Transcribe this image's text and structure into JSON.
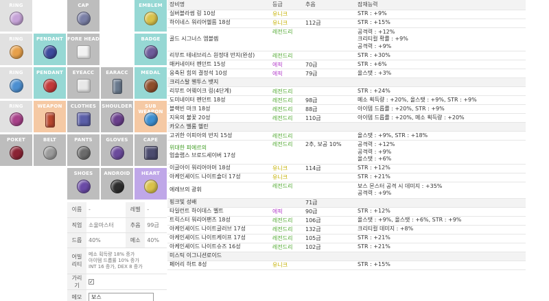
{
  "slots": [
    {
      "id": "ring1",
      "label": "RING",
      "bg": "#e1e1e1",
      "icon": "ring-icon",
      "color": "#c6a3d8"
    },
    {
      "id": "empty1",
      "label": "",
      "bg": "#ffffff",
      "icon": "",
      "color": ""
    },
    {
      "id": "cap",
      "label": "CAP",
      "bg": "#bdbdbd",
      "icon": "cap-icon",
      "color": "#7a7fa6"
    },
    {
      "id": "empty2",
      "label": "",
      "bg": "#ffffff",
      "icon": "",
      "color": ""
    },
    {
      "id": "emblem",
      "label": "EMBLEM",
      "bg": "#96d8d4",
      "icon": "emblem-icon",
      "color": "#d9c24a"
    },
    {
      "id": "ring2",
      "label": "RING",
      "bg": "#e1e1e1",
      "icon": "ring-icon",
      "color": "#e7a04a"
    },
    {
      "id": "pendant1",
      "label": "PENDANT",
      "bg": "#96d8d4",
      "icon": "pendant-icon",
      "color": "#3d4a9c"
    },
    {
      "id": "forehead",
      "label": "FORE HEAD",
      "bg": "#bdbdbd",
      "icon": "forehead-icon",
      "color": "#f2f2f2"
    },
    {
      "id": "empty3",
      "label": "",
      "bg": "#ffffff",
      "icon": "",
      "color": ""
    },
    {
      "id": "badge",
      "label": "BADGE",
      "bg": "#96d8d4",
      "icon": "badge-icon",
      "color": "#6d5b9a"
    },
    {
      "id": "ring3",
      "label": "RING",
      "bg": "#e1e1e1",
      "icon": "ring-icon",
      "color": "#4c8fd1"
    },
    {
      "id": "pendant2",
      "label": "PENDANT",
      "bg": "#96d8d4",
      "icon": "pendant-icon",
      "color": "#c23a3a"
    },
    {
      "id": "eyeacc",
      "label": "EYEACC",
      "bg": "#bdbdbd",
      "icon": "eyeacc-icon",
      "color": "#e8e8e8"
    },
    {
      "id": "earacc",
      "label": "EARACC",
      "bg": "#bdbdbd",
      "icon": "earacc-icon",
      "color": "#6a7a8e"
    },
    {
      "id": "medal",
      "label": "MEDAL",
      "bg": "#96d8d4",
      "icon": "medal-icon",
      "color": "#8e4e2b"
    },
    {
      "id": "ring4",
      "label": "RING",
      "bg": "#e1e1e1",
      "icon": "ring-icon",
      "color": "#a8418a"
    },
    {
      "id": "weapon",
      "label": "WEAPON",
      "bg": "#f5c9a4",
      "icon": "weapon-icon",
      "color": "#b8462e"
    },
    {
      "id": "clothes",
      "label": "CLOTHES",
      "bg": "#bdbdbd",
      "icon": "clothes-icon",
      "color": "#5b5fa8"
    },
    {
      "id": "shoulder",
      "label": "SHOULDER",
      "bg": "#bdbdbd",
      "icon": "shoulder-icon",
      "color": "#6a3f8c"
    },
    {
      "id": "subweapon",
      "label": "SUB WEAPON",
      "bg": "#f5c9a4",
      "icon": "subweapon-icon",
      "color": "#3d8fd1"
    },
    {
      "id": "pocket",
      "label": "POKET",
      "bg": "#bdbdbd",
      "icon": "pocket-icon",
      "color": "#8b2334"
    },
    {
      "id": "belt",
      "label": "BELT",
      "bg": "#bdbdbd",
      "icon": "belt-icon",
      "color": "#9a9a9a"
    },
    {
      "id": "pants",
      "label": "PANTS",
      "bg": "#bdbdbd",
      "icon": "pants-icon",
      "color": "#6b6b6b"
    },
    {
      "id": "gloves",
      "label": "GLOVES",
      "bg": "#bdbdbd",
      "icon": "gloves-icon",
      "color": "#6b4a9c"
    },
    {
      "id": "cape",
      "label": "CAPE",
      "bg": "#bdbdbd",
      "icon": "cape-icon",
      "color": "#4b4b6e"
    },
    {
      "id": "empty4",
      "label": "",
      "bg": "#ffffff",
      "icon": "",
      "color": ""
    },
    {
      "id": "empty5",
      "label": "",
      "bg": "#ffffff",
      "icon": "",
      "color": ""
    },
    {
      "id": "shoes",
      "label": "SHOES",
      "bg": "#bdbdbd",
      "icon": "shoes-icon",
      "color": "#6a4aa6"
    },
    {
      "id": "android",
      "label": "ANDROID",
      "bg": "#bdbdbd",
      "icon": "android-icon",
      "color": "#2c2c2c"
    },
    {
      "id": "heart",
      "label": "HEART",
      "bg": "#bfa7e8",
      "icon": "heart-icon",
      "color": "#d9c24a"
    }
  ],
  "info": {
    "name_label": "이름",
    "name_value": "-",
    "level_label": "레벨",
    "level_value": "-",
    "job_label": "직업",
    "job_value": "소울마스터",
    "force_label": "추옵",
    "force_value": "99급",
    "drop_label": "드롭",
    "drop_value": "40%",
    "meso_label": "메소",
    "meso_value": "40%",
    "ability_label": "어빌리티",
    "ability_lines": [
      "메소 획득량 18% 증가",
      "아이템 드롭률 10% 증가",
      "INT 16 증가, DEX 8 증가"
    ],
    "hide_label": "가리기",
    "hide_check": "✓",
    "memo_label": "메모",
    "memo_value": "보스"
  },
  "items": {
    "headers": [
      "장비명",
      "등급",
      "추옵",
      "잠재능력"
    ],
    "rows": [
      {
        "name": [
          "실버블라썸 링 10성"
        ],
        "grade": "유니크",
        "g": "unique",
        "force": "",
        "stats": [
          "STR : +9%"
        ]
      },
      {
        "name": [
          "하이네스 워리어헬름 18성"
        ],
        "grade": "유니크",
        "g": "unique",
        "force": "112급",
        "stats": [
          "STR : +15%"
        ]
      },
      {
        "name": [
          "골드 시그너스 엠블렘"
        ],
        "grade": "레전드리",
        "g": "legend",
        "force": "",
        "stats": [
          "공격력 : +12%",
          "크리티컬 확률 : +9%",
          "공격력 : +9%"
        ]
      },
      {
        "name": [
          "리부트 테네브리스 원정대 반지(완성)"
        ],
        "grade": "레전드리",
        "g": "legend",
        "force": "",
        "stats": [
          "STR : +30%"
        ]
      },
      {
        "name": [
          "매커네이터 펜던트 15성"
        ],
        "grade": "에픽",
        "g": "epic",
        "force": "70급",
        "stats": [
          "STR : +6%"
        ]
      },
      {
        "name": [
          "응축된 힘의 결정석 10성"
        ],
        "grade": "에픽",
        "g": "epic",
        "force": "79급",
        "stats": [
          "올스탯 : +3%"
        ]
      },
      {
        "name": [
          "크리스탈 웬투스 뱃지"
        ],
        "grade": "",
        "g": "",
        "force": "",
        "stats": [
          ""
        ]
      },
      {
        "name": [
          "리부트 어웨이크 링(4단계)"
        ],
        "grade": "레전드리",
        "g": "legend",
        "force": "",
        "stats": [
          "STR : +24%"
        ]
      },
      {
        "name": [
          "도미네이터 펜던트 18성"
        ],
        "grade": "레전드리",
        "g": "legend",
        "force": "98급",
        "stats": [
          "메소 획득량 : +20%, 올스탯 : +9%, STR : +9%"
        ]
      },
      {
        "name": [
          "블랙빈 마크 18성"
        ],
        "grade": "레전드리",
        "g": "legend",
        "force": "88급",
        "stats": [
          "아이템 드롭률 : +20%, STR : +9%"
        ]
      },
      {
        "name": [
          "지옥의 불꽃 20성"
        ],
        "grade": "레전드리",
        "g": "legend",
        "force": "110급",
        "stats": [
          "아이템 드롭률 : +20%, 메소 획득량 : +20%"
        ]
      },
      {
        "name": [
          "카오스 벨룸 헬린"
        ],
        "grade": "",
        "g": "",
        "force": "",
        "stats": [
          ""
        ]
      },
      {
        "name": [
          "고귀한 이피아의 반지 15성"
        ],
        "grade": "레전드리",
        "g": "legend",
        "force": "",
        "stats": [
          "올스탯 : +9%, STR : +18%"
        ]
      },
      {
        "name": [
          "위대한 피에르의",
          "업솔랩스 브로드세이버 17성"
        ],
        "grade": "레전드리",
        "g": "legend",
        "force": "2추, 보공 10%",
        "stats": [
          "공격력 : +12%",
          "공격력 : +9%",
          "올스탯 : +6%"
        ],
        "nameGreen": true
      },
      {
        "name": [
          "이글아이 워리어아머 18성"
        ],
        "grade": "유니크",
        "g": "unique",
        "force": "114급",
        "stats": [
          "STR : +12%"
        ]
      },
      {
        "name": [
          "아케인셰이드 나이트숄더 17성"
        ],
        "grade": "유니크",
        "g": "unique",
        "force": "",
        "stats": [
          "STR : +21%"
        ]
      },
      {
        "name": [
          "에레브의 광휘"
        ],
        "grade": "레전드리",
        "g": "legend",
        "force": "",
        "stats": [
          "보스 몬스터 공격 시 데미지 : +35%",
          "공격력 : +9%"
        ]
      },
      {
        "name": [
          "핑크빛 성배"
        ],
        "grade": "",
        "g": "",
        "force": "71급",
        "stats": [
          ""
        ]
      },
      {
        "name": [
          "타일런트 하이데스 벨트"
        ],
        "grade": "에픽",
        "g": "epic",
        "force": "90급",
        "stats": [
          "STR : +12%"
        ]
      },
      {
        "name": [
          "트릭스터 워리어팬츠 18성"
        ],
        "grade": "레전드리",
        "g": "legend",
        "force": "106급",
        "stats": [
          "올스탯 : +9%, 올스탯 : +6%, STR : +9%"
        ]
      },
      {
        "name": [
          "아케인셰이드 나이트글러브 17성"
        ],
        "grade": "레전드리",
        "g": "legend",
        "force": "132급",
        "stats": [
          "크리티컬 데미지 : +8%"
        ]
      },
      {
        "name": [
          "아케인셰이드 나이트케이프 17성"
        ],
        "grade": "레전드리",
        "g": "legend",
        "force": "105급",
        "stats": [
          "STR : +21%"
        ]
      },
      {
        "name": [
          "아케인셰이드 나이트슈즈 16성"
        ],
        "grade": "레전드리",
        "g": "legend",
        "force": "102급",
        "stats": [
          "STR : +21%"
        ]
      },
      {
        "name": [
          "미스틱 이그니션로이드"
        ],
        "grade": "",
        "g": "",
        "force": "",
        "stats": [
          ""
        ]
      },
      {
        "name": [
          "페어리 하트 8성"
        ],
        "grade": "유니크",
        "g": "unique",
        "force": "",
        "stats": [
          "STR : +15%"
        ]
      }
    ]
  }
}
